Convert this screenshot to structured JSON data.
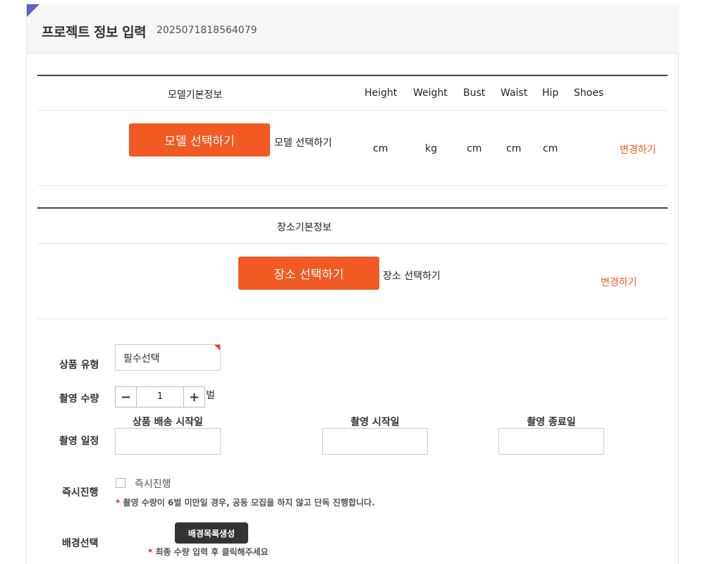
{
  "header": {
    "title": "프로젝트 정보 입력",
    "project_id": "2025071818564079"
  },
  "model_section": {
    "heading": "모델기본정보",
    "columns": [
      "Height",
      "Weight",
      "Bust",
      "Waist",
      "Hip",
      "Shoes"
    ],
    "units": [
      "cm",
      "kg",
      "cm",
      "cm",
      "cm",
      ""
    ],
    "select_button": "모델 선택하기",
    "selected_text": "모델 선택하기",
    "change_link": "변경하기"
  },
  "location_section": {
    "heading": "장소기본정보",
    "select_button": "장소 선택하기",
    "selected_text": "장소 선택하기",
    "change_link": "변경하기"
  },
  "form": {
    "product_type": {
      "label": "상품 유형",
      "value": "필수선택"
    },
    "quantity": {
      "label": "촬영 수량",
      "minus": "−",
      "plus": "+",
      "value": "1",
      "unit": "벌"
    },
    "schedule": {
      "label": "촬영 일정",
      "fields": [
        "상품 배송 시작일",
        "촬영 시작일",
        "촬영 종료일"
      ]
    },
    "immediate": {
      "label": "즉시진행",
      "checkbox_label": "즉시진행",
      "note_star": "*",
      "note": " 촬영 수량이 6벌 미만일 경우, 공동 모집을 하지 않고 단독 진행합니다."
    },
    "background": {
      "label": "배경선택",
      "button": "배경목록생성",
      "note_star": "*",
      "note": " 최종 수량 입력 후 클릭해주세요"
    }
  },
  "colors": {
    "accent": "#f15a22",
    "corner": "#5c62c8",
    "dark_button": "#333333"
  }
}
